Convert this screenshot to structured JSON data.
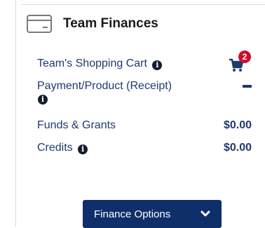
{
  "section": {
    "title": "Team Finances",
    "icon": "credit-card-icon"
  },
  "rows": {
    "cart": {
      "label": "Team's Shopping Cart",
      "badge_count": "2",
      "icon": "shopping-cart-icon"
    },
    "payment": {
      "label": "Payment/Product (Receipt)",
      "value": "—"
    },
    "funds": {
      "label": "Funds & Grants",
      "value": "$0.00"
    },
    "credits": {
      "label": "Credits",
      "value": "$0.00"
    }
  },
  "finance_button": {
    "label": "Finance Options",
    "icon": "chevron-down-icon"
  },
  "colors": {
    "primary": "#0f2f6b",
    "text": "#1f3a6e",
    "badge": "#c8102e"
  }
}
